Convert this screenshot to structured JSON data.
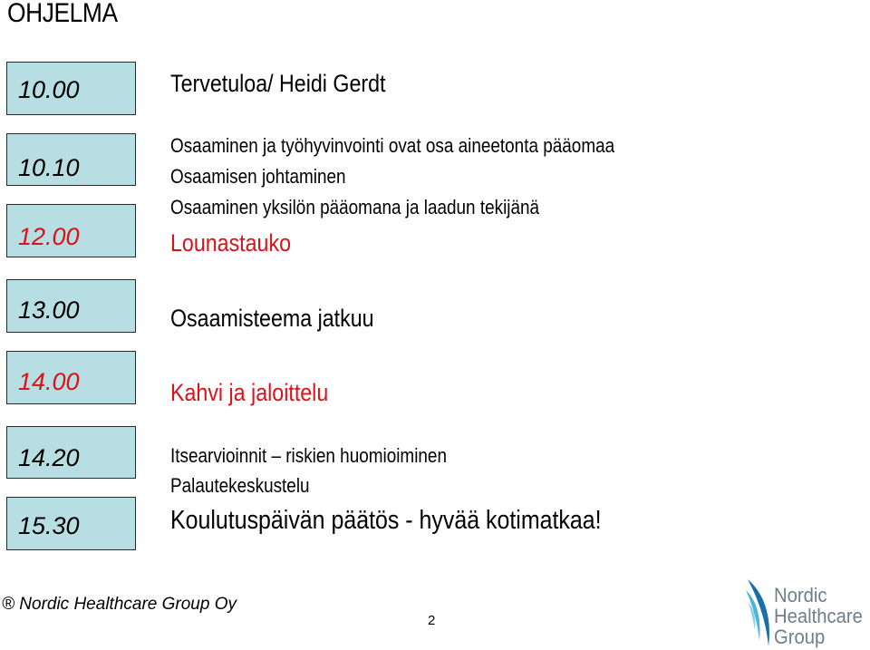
{
  "page": {
    "title": "OHJELMA",
    "page_number": "2",
    "footer": "® Nordic Healthcare Group Oy"
  },
  "times": [
    {
      "time": "10.00",
      "color": "#000000"
    },
    {
      "time": "10.10",
      "color": "#000000"
    },
    {
      "time": "12.00",
      "color": "#d7141c"
    },
    {
      "time": "13.00",
      "color": "#000000"
    },
    {
      "time": "14.00",
      "color": "#d7141c"
    },
    {
      "time": "14.20",
      "color": "#000000"
    },
    {
      "time": "15.30",
      "color": "#000000"
    }
  ],
  "agenda": {
    "welcome": "Tervetuloa/ Heidi Gerdt",
    "block1": [
      "Osaaminen ja työhyvinvointi ovat osa aineetonta pääomaa",
      "Osaamisen johtaminen",
      "Osaaminen yksilön pääomana ja laadun tekijänä"
    ],
    "lunch": "Lounastauko",
    "continue": "Osaamisteema jatkuu",
    "coffee": "Kahvi ja jaloittelu",
    "block2": [
      "Itsearvioinnit – riskien huomioiminen",
      "Palautekeskustelu"
    ],
    "closing": "Koulutuspäivän päätös - hyvää kotimatkaa!"
  },
  "logo": {
    "lines": [
      "Nordic",
      "Healthcare",
      "Group"
    ],
    "icon": "wave-leaf-icon"
  },
  "colors": {
    "accent_red": "#d7141c",
    "time_box_fill": "#b7dfe3",
    "logo_blue": "#1b6fa8",
    "logo_text": "#6f7f8a"
  }
}
